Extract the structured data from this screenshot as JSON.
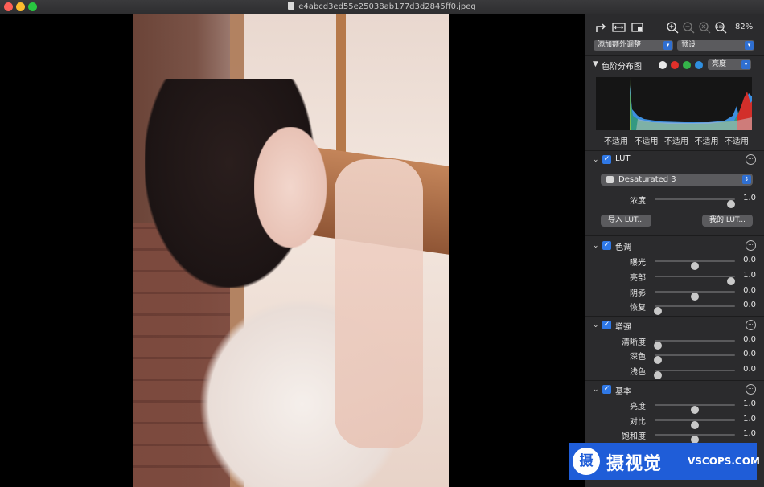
{
  "window": {
    "title": "e4abcd3ed55e25038ab177d3d2845ff0.jpeg"
  },
  "toolbar": {
    "icons": [
      "rotate-icon",
      "fit-width-icon",
      "crop-icon",
      "zoom-in-icon",
      "zoom-out-icon",
      "zoom-reset-icon",
      "zoom-100-icon"
    ],
    "zoom_label": "82%",
    "add_adjust": "添加额外调整",
    "preset": "预设"
  },
  "histogram": {
    "title": "色阶分布图",
    "channel": "亮度",
    "channel_colors": [
      "#e8e8e8",
      "#e0302a",
      "#34b34a",
      "#2f8fe0"
    ],
    "na_labels": [
      "不适用",
      "不适用",
      "不适用",
      "不适用",
      "不适用"
    ]
  },
  "lut": {
    "title": "LUT",
    "selected": "Desaturated 3",
    "opacity_label": "浓度",
    "opacity_value": "1.0",
    "opacity_level": 0.95,
    "import_label": "导入 LUT...",
    "my_lut_label": "我的 LUT..."
  },
  "tone": {
    "title": "色调",
    "rows": [
      {
        "label": "曝光",
        "value": "0.0",
        "level": 0.5
      },
      {
        "label": "亮部",
        "value": "1.0",
        "level": 0.95
      },
      {
        "label": "阴影",
        "value": "0.0",
        "level": 0.5
      },
      {
        "label": "恢复",
        "value": "0.0",
        "level": 0.04
      }
    ]
  },
  "enhance": {
    "title": "增强",
    "rows": [
      {
        "label": "清晰度",
        "value": "0.0",
        "level": 0.04
      },
      {
        "label": "深色",
        "value": "0.0",
        "level": 0.04
      },
      {
        "label": "浅色",
        "value": "0.0",
        "level": 0.04
      }
    ]
  },
  "basic": {
    "title": "基本",
    "rows": [
      {
        "label": "亮度",
        "value": "1.0",
        "level": 0.5
      },
      {
        "label": "对比",
        "value": "1.0",
        "level": 0.5
      },
      {
        "label": "饱和度",
        "value": "1.0",
        "level": 0.5
      }
    ]
  },
  "watermark": {
    "logo": "摄",
    "cn": "摄视觉",
    "en": "VSCOPS.COM"
  }
}
